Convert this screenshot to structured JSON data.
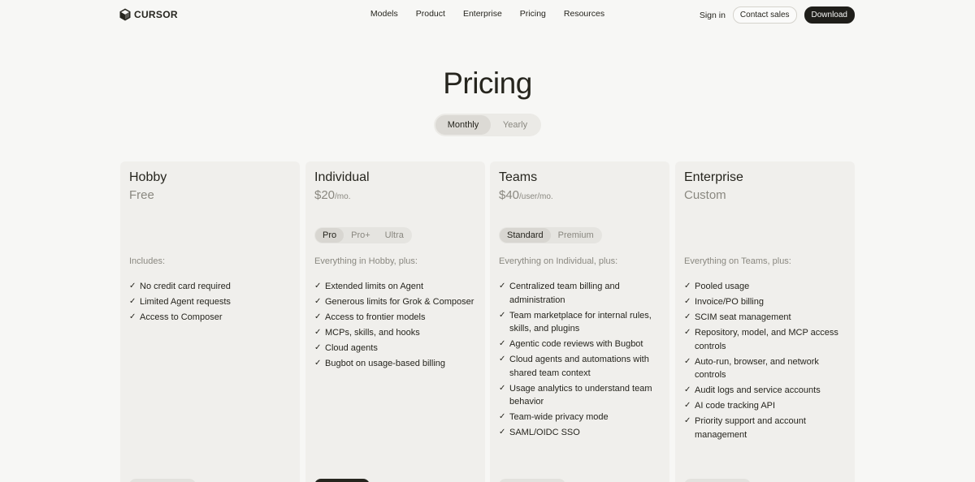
{
  "header": {
    "logo_text": "CURSOR",
    "menu": [
      "Models",
      "Product",
      "Enterprise",
      "Pricing",
      "Resources"
    ],
    "sign_in": "Sign in",
    "contact_sales": "Contact sales",
    "download": "Download"
  },
  "page": {
    "title": "Pricing",
    "billing": {
      "monthly": "Monthly",
      "yearly": "Yearly",
      "selected": "Monthly"
    }
  },
  "plans": [
    {
      "name": "Hobby",
      "price": "Free",
      "unit": "",
      "tiers": [],
      "includes": "Includes:",
      "features": [
        "No credit card required",
        "Limited Agent requests",
        "Access to Composer"
      ],
      "cta_style": "light"
    },
    {
      "name": "Individual",
      "price": "$20",
      "unit": "/mo.",
      "tiers": [
        "Pro",
        "Pro+",
        "Ultra"
      ],
      "selected_tier": "Pro",
      "includes": "Everything in Hobby, plus:",
      "features": [
        "Extended limits on Agent",
        "Generous limits for Grok & Composer",
        "Access to frontier models",
        "MCPs, skills, and hooks",
        "Cloud agents",
        "Bugbot on usage-based billing"
      ],
      "cta_style": "dark"
    },
    {
      "name": "Teams",
      "price": "$40",
      "unit": "/user/mo.",
      "tiers": [
        "Standard",
        "Premium"
      ],
      "selected_tier": "Standard",
      "includes": "Everything on Individual, plus:",
      "features": [
        "Centralized team billing and administration",
        "Team marketplace for internal rules, skills, and plugins",
        "Agentic code reviews with Bugbot",
        "Cloud agents and automations with shared team context",
        "Usage analytics to understand team behavior",
        "Team-wide privacy mode",
        "SAML/OIDC SSO"
      ],
      "cta_style": "light"
    },
    {
      "name": "Enterprise",
      "price": "Custom",
      "unit": "",
      "tiers": [],
      "includes": "Everything on Teams, plus:",
      "features": [
        "Pooled usage",
        "Invoice/PO billing",
        "SCIM seat management",
        "Repository, model, and MCP access controls",
        "Auto-run, browser, and network controls",
        "Audit logs and service accounts",
        "AI code tracking API",
        "Priority support and account management"
      ],
      "cta_style": "light"
    }
  ],
  "icons": {
    "logo": "cursor-cube-icon",
    "feature": "check-icon"
  },
  "colors": {
    "background": "#f7f7f5",
    "card": "#f0efec",
    "text": "#26251e",
    "muted": "#8a8880",
    "dark_button": "#1f1e1a"
  }
}
